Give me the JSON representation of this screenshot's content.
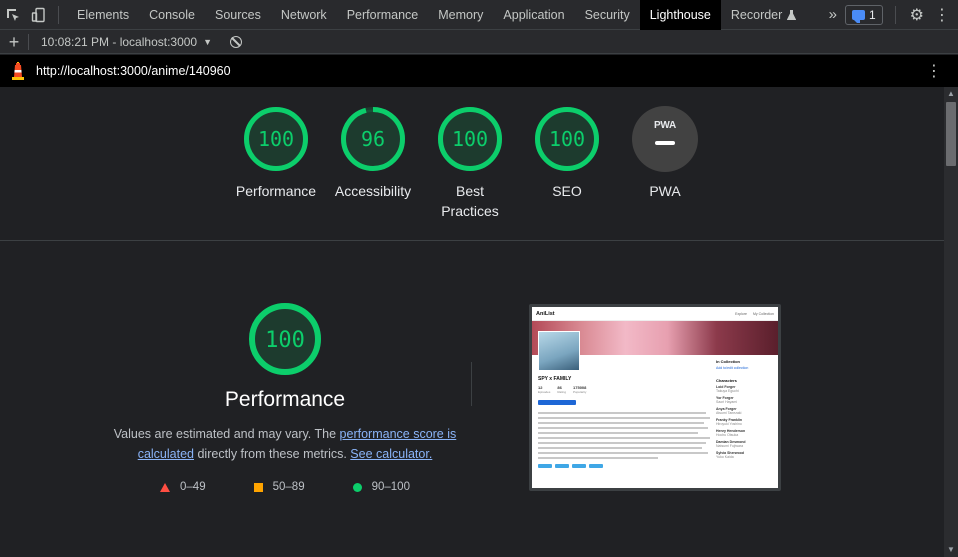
{
  "devtools": {
    "tabs": [
      "Elements",
      "Console",
      "Sources",
      "Network",
      "Performance",
      "Memory",
      "Application",
      "Security",
      "Lighthouse",
      "Recorder"
    ],
    "active_tab": "Lighthouse",
    "overflow_label": "»",
    "issues_count": "1"
  },
  "lighthouse_toolbar": {
    "report_label": "10:08:21 PM - localhost:3000"
  },
  "url_bar": {
    "url": "http://localhost:3000/anime/140960"
  },
  "summary": {
    "gauges": [
      {
        "score": "100",
        "label": "Performance",
        "fraction": 1.0
      },
      {
        "score": "96",
        "label": "Accessibility",
        "fraction": 0.96
      },
      {
        "score": "100",
        "label": "Best Practices",
        "fraction": 1.0
      },
      {
        "score": "100",
        "label": "SEO",
        "fraction": 1.0
      }
    ],
    "pwa": {
      "badge": "PWA",
      "label": "PWA"
    }
  },
  "performance": {
    "score": "100",
    "fraction": 1.0,
    "title": "Performance",
    "desc_prefix": "Values are estimated and may vary. The ",
    "desc_link1": "performance score is calculated",
    "desc_middle": " directly from these metrics. ",
    "desc_link2": "See calculator.",
    "legend": [
      "0–49",
      "50–89",
      "90–100"
    ]
  },
  "screenshot": {
    "brand": "AniList",
    "nav": [
      "Explore",
      "My Collection"
    ],
    "title": "SPY x FAMILY",
    "stats": [
      "12",
      "86",
      "175008"
    ],
    "stat_labels": [
      "Episodes",
      "Rating",
      "Popularity"
    ],
    "side_heading": "In Collection",
    "side_link": "Add to/edit collection",
    "characters_heading": "Characters",
    "characters": [
      {
        "name": "Loid Forger",
        "sub": "Takuya Eguchi"
      },
      {
        "name": "Yor Forger",
        "sub": "Saori Hayami"
      },
      {
        "name": "Anya Forger",
        "sub": "Atsumi Tanezaki"
      },
      {
        "name": "Franky Franklin",
        "sub": "Hiroyuki Yoshino"
      },
      {
        "name": "Henry Henderson",
        "sub": "Hochu Otsuka"
      },
      {
        "name": "Damian Desmond",
        "sub": "Natsumi Fujiwara"
      },
      {
        "name": "Sylvia Sherwood",
        "sub": "Yuko Kaida"
      }
    ]
  },
  "colors": {
    "pass": "#0cce6b",
    "pass_bg": "#0cce6b26",
    "average": "#ffa400",
    "fail": "#ff4e42",
    "link": "#8ab4f8"
  }
}
